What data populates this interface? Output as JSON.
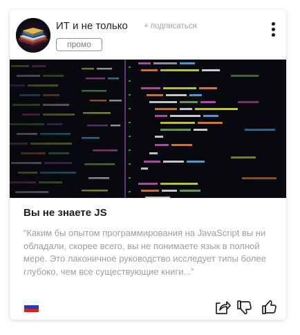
{
  "channel": {
    "name": "ИТ и не только",
    "subscribe_label": "+ подписаться",
    "tag": "промо",
    "avatar_icon": "book-stack-icon"
  },
  "post": {
    "title": "Вы не знаете JS",
    "excerpt": "“Каким бы опытом программирования на JavaScript вы ни обладали, скорее всего, вы не понимаете язык в полной мере. Это лаконичное руководство исследует типы более глубоко, чем все существующие книги...”",
    "cover_icon": "code-editor-screenshot"
  },
  "footer": {
    "language_icon": "russia-flag-icon",
    "actions": [
      "share-icon",
      "dislike-icon",
      "like-icon"
    ]
  },
  "colors": {
    "text_primary": "#1e1e1e",
    "text_muted": "#9e9e9e",
    "code_background": "#07090e"
  }
}
